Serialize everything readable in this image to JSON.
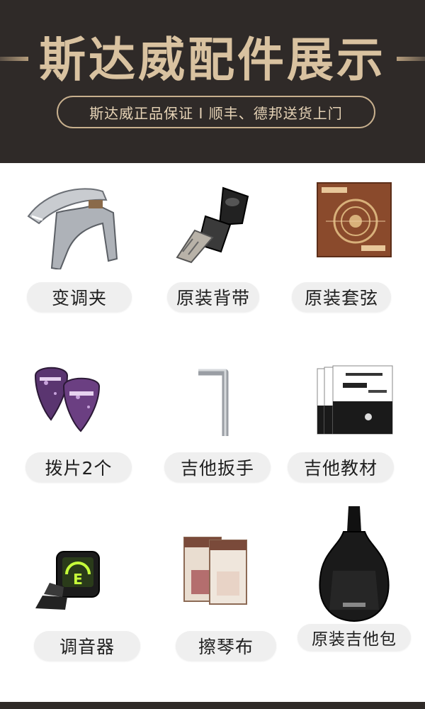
{
  "header": {
    "title": "斯达威配件展示",
    "subtitle": "斯达威正品保证 I 顺丰、德邦送货上门"
  },
  "items": [
    {
      "label": "变调夹"
    },
    {
      "label": "原装背带"
    },
    {
      "label": "原装套弦"
    },
    {
      "label": "拨片2个"
    },
    {
      "label": "吉他扳手"
    },
    {
      "label": "吉他教材"
    },
    {
      "label": "调音器"
    },
    {
      "label": "擦琴布"
    },
    {
      "label": "原装吉他包"
    }
  ],
  "colors": {
    "header_bg": "#2f2a28",
    "title_gold": "#d9c2a0",
    "pill_bg": "#efefef"
  }
}
